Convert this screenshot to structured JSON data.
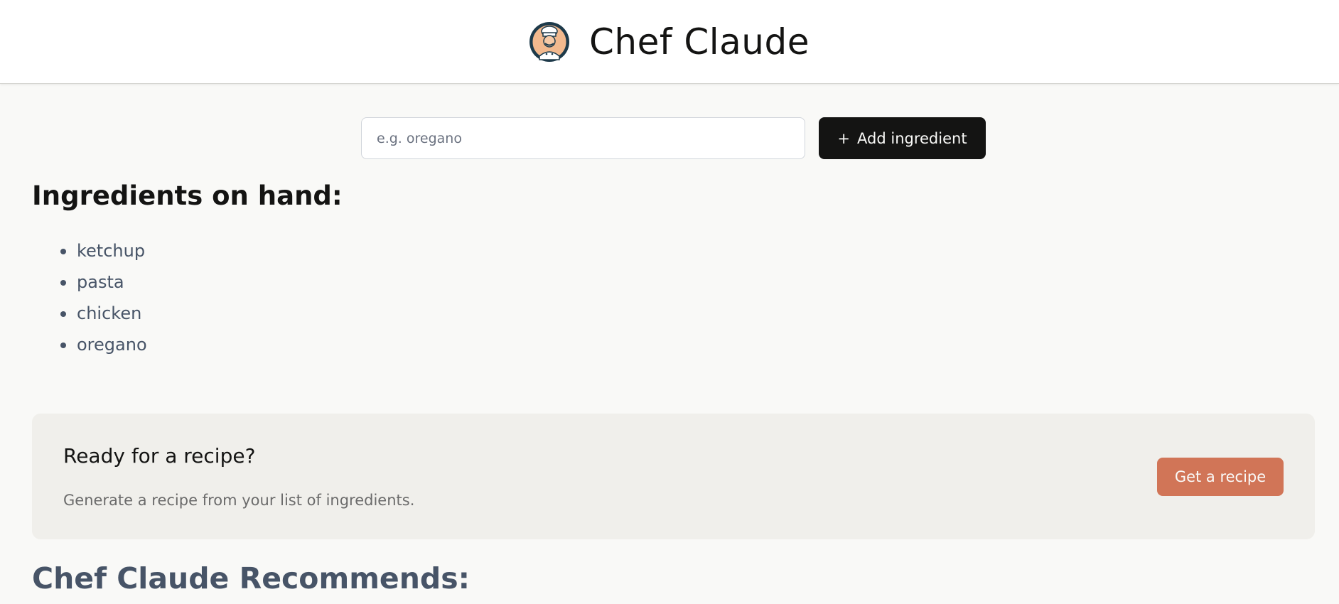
{
  "header": {
    "title": "Chef Claude",
    "logo_icon": "chef-avatar-icon"
  },
  "form": {
    "input_placeholder": "e.g. oregano",
    "input_value": "",
    "add_button_icon": "+",
    "add_button_label": "Add ingredient"
  },
  "ingredients": {
    "heading": "Ingredients on hand:",
    "items": [
      "ketchup",
      "pasta",
      "chicken",
      "oregano"
    ]
  },
  "recipe_card": {
    "title": "Ready for a recipe?",
    "description": "Generate a recipe from your list of ingredients.",
    "button_label": "Get a recipe"
  },
  "recommendations": {
    "heading": "Chef Claude Recommends:"
  },
  "colors": {
    "page_background": "#f9f9f7",
    "header_background": "#ffffff",
    "add_button_background": "#141413",
    "card_background": "#f0efeb",
    "accent": "#d17557",
    "muted_text": "#475467"
  }
}
